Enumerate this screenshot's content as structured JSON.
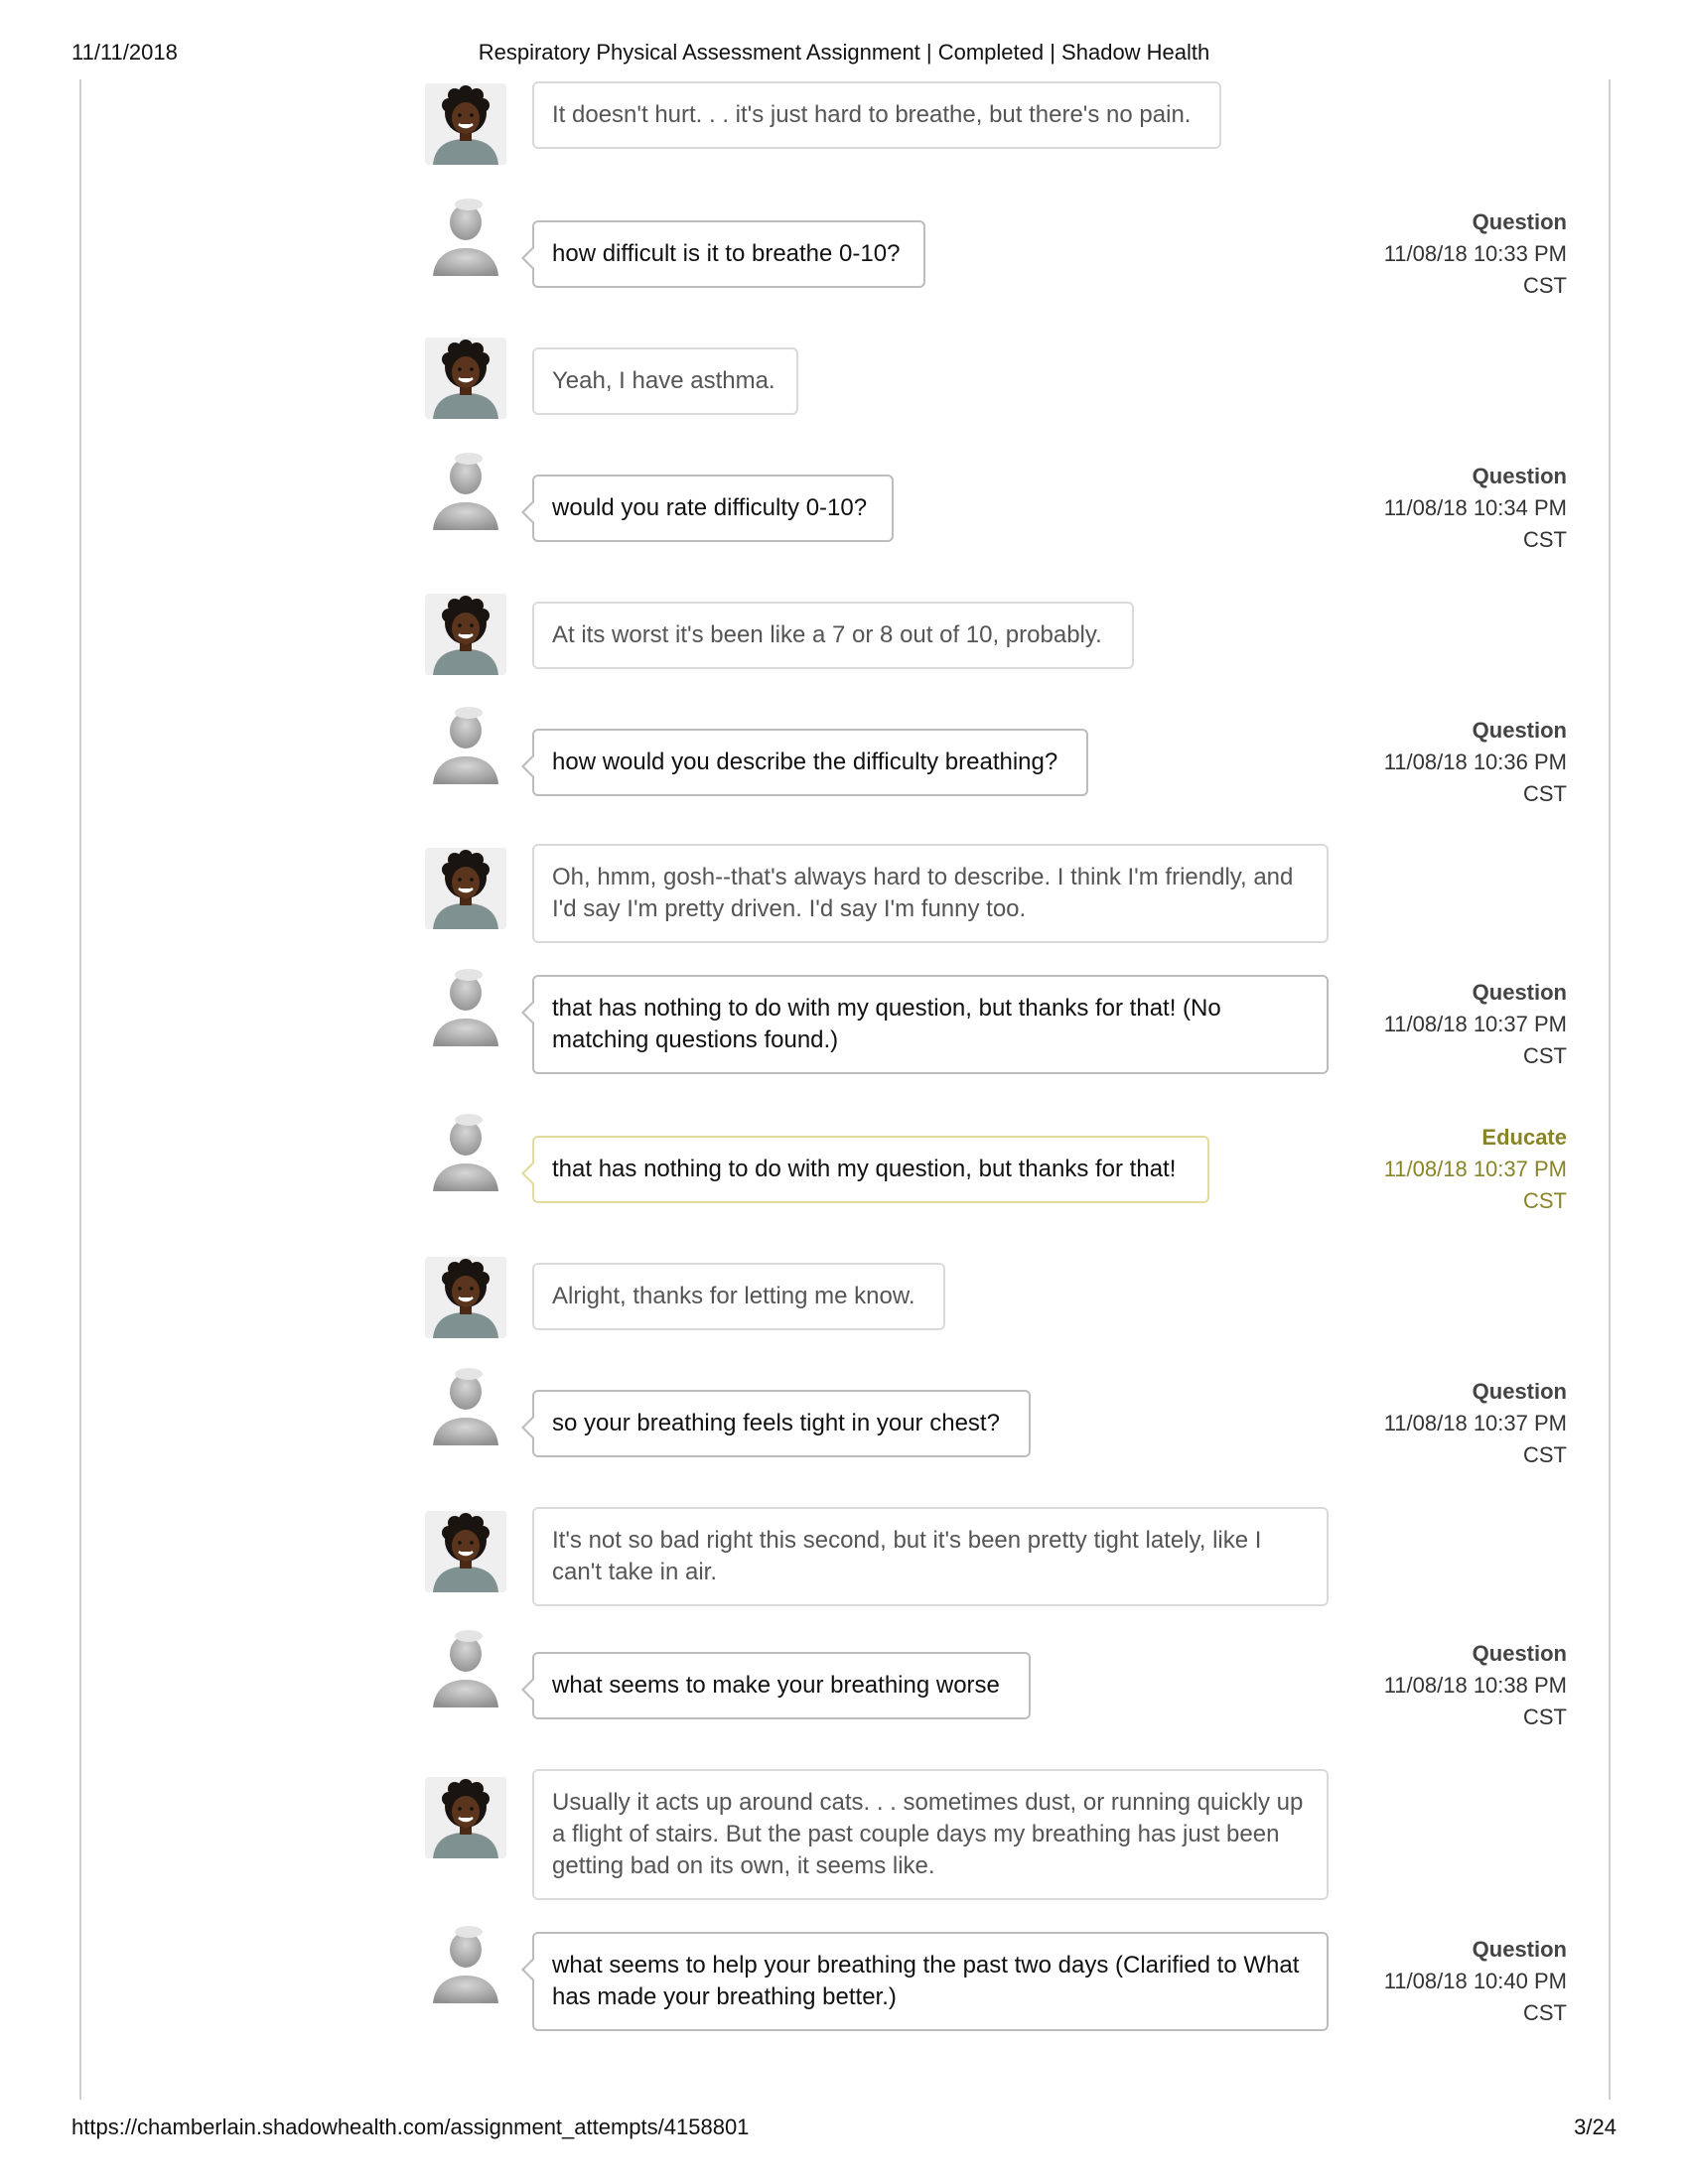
{
  "header": {
    "date": "11/11/2018",
    "title": "Respiratory Physical Assessment Assignment | Completed | Shadow Health"
  },
  "footer": {
    "url": "https://chamberlain.shadowhealth.com/assignment_attempts/4158801",
    "page": "3/24"
  },
  "colors": {
    "educate_accent": "#8a8428",
    "bubble_border": "#bdbdbd"
  },
  "transcript": [
    {
      "speaker": "patient",
      "text": "It doesn't hurt. . . it's just hard to breathe, but there's no pain."
    },
    {
      "speaker": "student",
      "text": "how difficult is it to breathe 0-10?",
      "kind": "Question",
      "date": "11/08/18 10:33 PM",
      "tz": "CST"
    },
    {
      "speaker": "patient",
      "text": "Yeah, I have asthma."
    },
    {
      "speaker": "student",
      "text": "would you rate difficulty 0-10?",
      "kind": "Question",
      "date": "11/08/18 10:34 PM",
      "tz": "CST"
    },
    {
      "speaker": "patient",
      "text": "At its worst it's been like a 7 or 8 out of 10, probably."
    },
    {
      "speaker": "student",
      "text": "how would you describe the difficulty breathing?",
      "kind": "Question",
      "date": "11/08/18 10:36 PM",
      "tz": "CST"
    },
    {
      "speaker": "patient",
      "text": "Oh, hmm, gosh--that's always hard to describe. I think I'm friendly, and I'd say I'm pretty driven. I'd say I'm funny too."
    },
    {
      "speaker": "student",
      "text": "that has nothing to do with my question, but thanks for that! (No matching questions found.)",
      "kind": "Question",
      "date": "11/08/18 10:37 PM",
      "tz": "CST"
    },
    {
      "speaker": "educate",
      "text": "that has nothing to do with my question, but thanks for that!",
      "kind": "Educate",
      "date": "11/08/18 10:37 PM",
      "tz": "CST"
    },
    {
      "speaker": "patient",
      "text": "Alright, thanks for letting me know."
    },
    {
      "speaker": "student",
      "text": "so your breathing feels tight in your chest?",
      "kind": "Question",
      "date": "11/08/18 10:37 PM",
      "tz": "CST"
    },
    {
      "speaker": "patient",
      "text": "It's not so bad right this second, but it's been pretty tight lately, like I can't take in air."
    },
    {
      "speaker": "student",
      "text": "what seems to make your breathing worse",
      "kind": "Question",
      "date": "11/08/18 10:38 PM",
      "tz": "CST"
    },
    {
      "speaker": "patient",
      "text": "Usually it acts up around cats. . . sometimes dust, or running quickly up a flight of stairs. But the past couple days my breathing has just been getting bad on its own, it seems like."
    },
    {
      "speaker": "student",
      "text": "what seems to help your breathing the past two days (Clarified to What has made your breathing better.)",
      "kind": "Question",
      "date": "11/08/18 10:40 PM",
      "tz": "CST"
    }
  ]
}
